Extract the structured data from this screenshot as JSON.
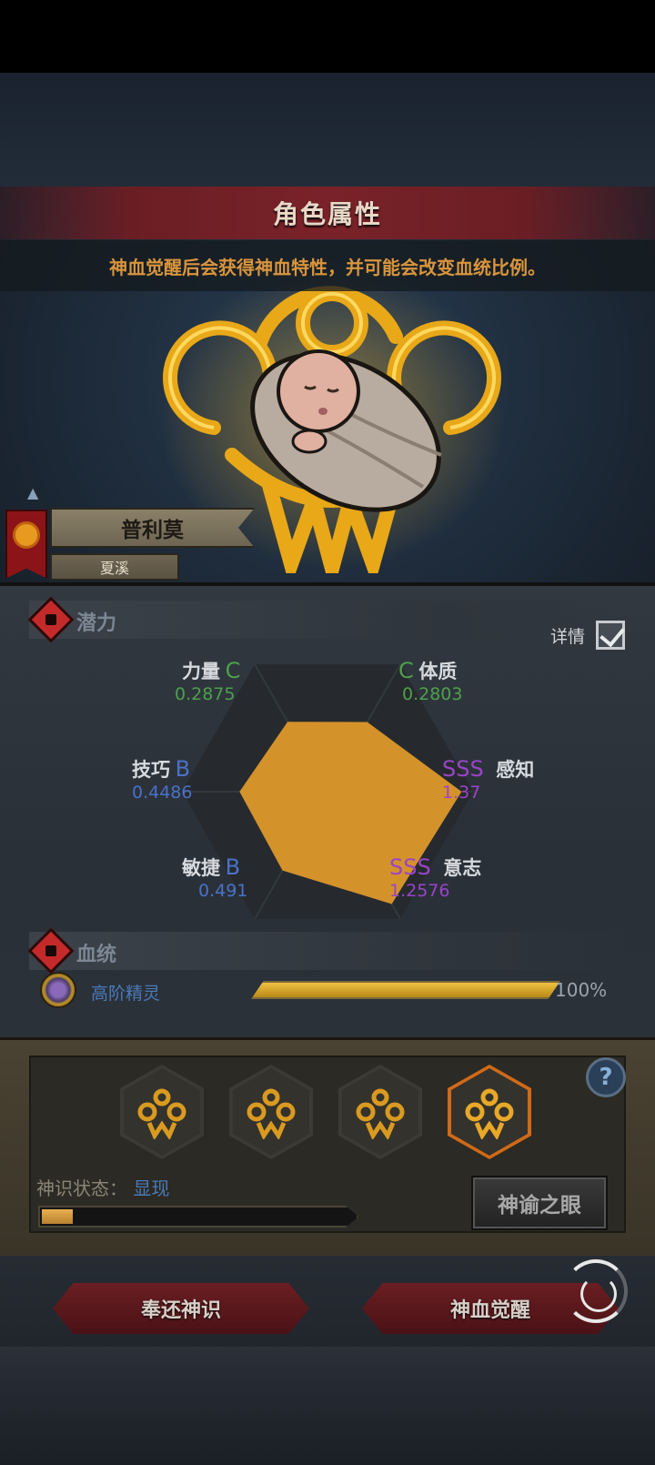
{
  "header": {
    "title": "角色属性",
    "subtitle": "神血觉醒后会获得神血特性，并可能会改变血统比例。"
  },
  "character": {
    "name": "普利莫",
    "house": "夏溪"
  },
  "potential": {
    "label": "潜力",
    "detail_label": "详情",
    "detail_checked": true,
    "stats": [
      {
        "name": "力量",
        "grade": "C",
        "value": "0.2875"
      },
      {
        "name": "体质",
        "grade": "C",
        "value": "0.2803"
      },
      {
        "name": "感知",
        "grade": "SSS",
        "value": "1.37"
      },
      {
        "name": "意志",
        "grade": "SSS",
        "value": "1.2576"
      },
      {
        "name": "敏捷",
        "grade": "B",
        "value": "0.491"
      },
      {
        "name": "技巧",
        "grade": "B",
        "value": "0.4486"
      }
    ]
  },
  "chart_data": {
    "type": "radar",
    "categories": [
      "力量",
      "体质",
      "感知",
      "意志",
      "敏捷",
      "技巧"
    ],
    "values": [
      0.2875,
      0.2803,
      1.37,
      1.2576,
      0.491,
      0.4486
    ],
    "fill_color": "#d4922a"
  },
  "bloodline": {
    "label": "血统",
    "items": [
      {
        "name": "高阶精灵",
        "percent_text": "100%",
        "fraction": 1.0
      }
    ]
  },
  "divinity": {
    "state_label": "神识状态：",
    "state_value": "显现",
    "progress_fraction": 0.1,
    "oracle_button": "神谕之眼",
    "help_label": "?",
    "slots": [
      {
        "icon": "divine-emblem-icon",
        "active": false
      },
      {
        "icon": "divine-emblem-icon",
        "active": false
      },
      {
        "icon": "divine-emblem-icon",
        "active": false
      },
      {
        "icon": "divine-emblem-icon",
        "active": true
      }
    ]
  },
  "actions": {
    "return_label": "奉还神识",
    "awaken_label": "神血觉醒"
  },
  "colors": {
    "grade_C": "#4ea04a",
    "grade_B": "#4a72c8",
    "grade_SSS": "#9a44c8",
    "accent_gold": "#e8b030",
    "banner_red": "#7a2229"
  }
}
